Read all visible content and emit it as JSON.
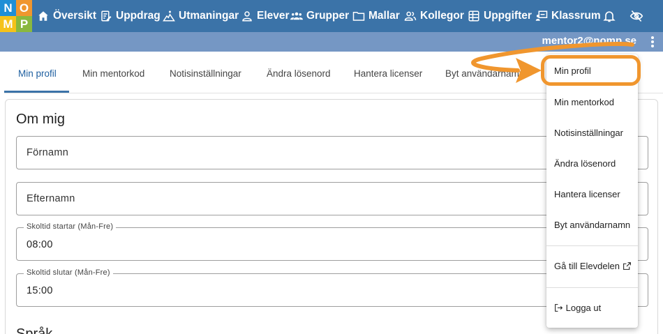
{
  "logo": {
    "letters": [
      "N",
      "O",
      "M",
      "P"
    ],
    "colors": [
      "#1f8fd6",
      "#f0962e",
      "#f5c21a",
      "#8ab83f"
    ]
  },
  "nav": {
    "items": [
      {
        "label": "Översikt",
        "icon": "home-icon"
      },
      {
        "label": "Uppdrag",
        "icon": "edit-doc-icon"
      },
      {
        "label": "Utmaningar",
        "icon": "hiker-icon"
      },
      {
        "label": "Elever",
        "icon": "person-icon"
      },
      {
        "label": "Grupper",
        "icon": "group-icon"
      },
      {
        "label": "Mallar",
        "icon": "folder-icon"
      },
      {
        "label": "Kollegor",
        "icon": "colleagues-icon"
      },
      {
        "label": "Uppgifter",
        "icon": "tasks-icon"
      },
      {
        "label": "Klassrum",
        "icon": "classroom-icon"
      }
    ],
    "bell_icon": "bell-icon",
    "eye_icon": "eye-off-icon",
    "color": "#3b73a8"
  },
  "subbar": {
    "email": "mentor2@nomp.se",
    "color": "#7597c4"
  },
  "tabs": [
    "Min profil",
    "Min mentorkod",
    "Notisinställningar",
    "Ändra lösenord",
    "Hantera licenser",
    "Byt användarnamn"
  ],
  "active_tab": "Min profil",
  "card": {
    "title": "Om mig",
    "fields": [
      {
        "placeholder": "Förnamn"
      },
      {
        "placeholder": "Efternamn"
      },
      {
        "label": "Skoltid startar (Mån-Fre)",
        "value": "08:00"
      },
      {
        "label": "Skoltid slutar (Mån-Fre)",
        "value": "15:00"
      }
    ],
    "next_section": "Språk"
  },
  "menu": {
    "items": [
      "Min profil",
      "Min mentorkod",
      "Notisinställningar",
      "Ändra lösenord",
      "Hantera licenser",
      "Byt användarnamn"
    ],
    "student_link": "Gå till Elevdelen",
    "logout": "Logga ut"
  },
  "annotation_color": "#f0962e"
}
